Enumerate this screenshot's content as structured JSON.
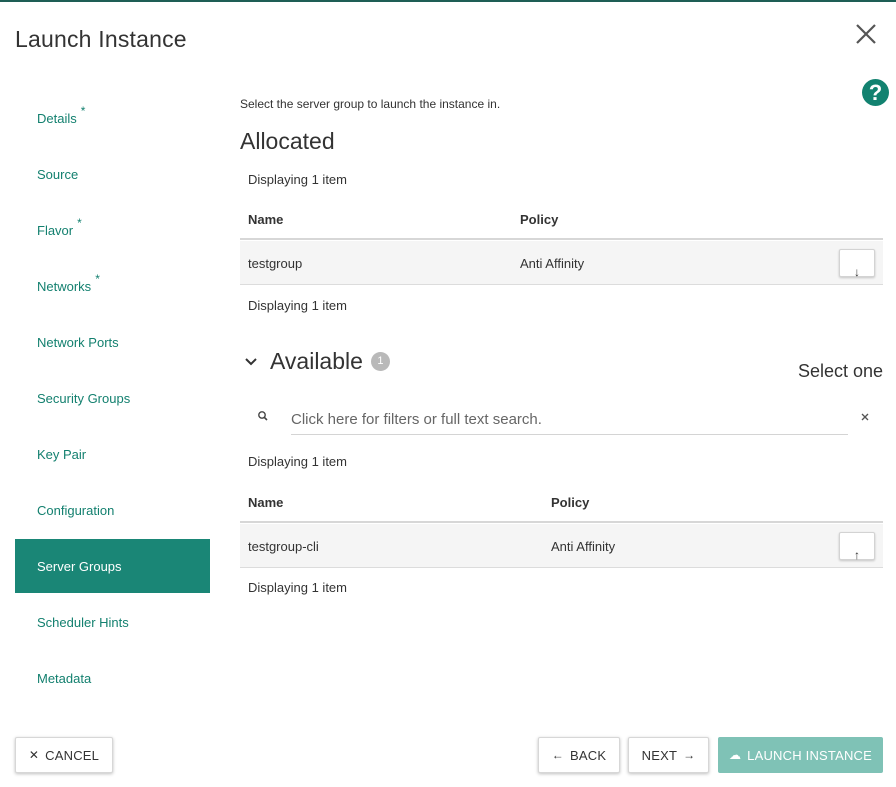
{
  "dialog": {
    "title": "Launch Instance",
    "close_icon": "close-icon",
    "help_glyph": "?",
    "help_icon": "help-icon",
    "accent_color": "#1a8676"
  },
  "nav": {
    "items": [
      {
        "label": "Details",
        "required": "*"
      },
      {
        "label": "Source",
        "required": ""
      },
      {
        "label": "Flavor",
        "required": "*"
      },
      {
        "label": "Networks",
        "required": "*"
      },
      {
        "label": "Network Ports",
        "required": ""
      },
      {
        "label": "Security Groups",
        "required": ""
      },
      {
        "label": "Key Pair",
        "required": ""
      },
      {
        "label": "Configuration",
        "required": ""
      },
      {
        "label": "Server Groups",
        "required": "",
        "active": true
      },
      {
        "label": "Scheduler Hints",
        "required": ""
      },
      {
        "label": "Metadata",
        "required": ""
      }
    ]
  },
  "main": {
    "intro": "Select the server group to launch the instance in.",
    "allocated": {
      "heading": "Allocated",
      "displaying_top": "Displaying 1 item",
      "col_name": "Name",
      "col_policy": "Policy",
      "rows": [
        {
          "name": "testgroup",
          "policy": "Anti Affinity",
          "action_glyph": "↓",
          "action_icon": "arrow-down-icon"
        }
      ],
      "displaying_bottom": "Displaying 1 item"
    },
    "available": {
      "heading": "Available",
      "count": "1",
      "select_hint": "Select one",
      "search_placeholder": "Click here for filters or full text search.",
      "search_value": "",
      "displaying_top": "Displaying 1 item",
      "col_name": "Name",
      "col_policy": "Policy",
      "rows": [
        {
          "name": "testgroup-cli",
          "policy": "Anti Affinity",
          "action_glyph": "↑",
          "action_icon": "arrow-up-icon"
        }
      ],
      "displaying_bottom": "Displaying 1 item"
    }
  },
  "footer": {
    "cancel_label": "CANCEL",
    "cancel_glyph": "✕",
    "back_label": "BACK",
    "back_glyph": "←",
    "next_label": "NEXT",
    "next_glyph": "→",
    "launch_label": "LAUNCH INSTANCE",
    "launch_glyph": "☁",
    "launch_icon": "cloud-upload-icon",
    "launch_color": "#7fc2b6"
  }
}
